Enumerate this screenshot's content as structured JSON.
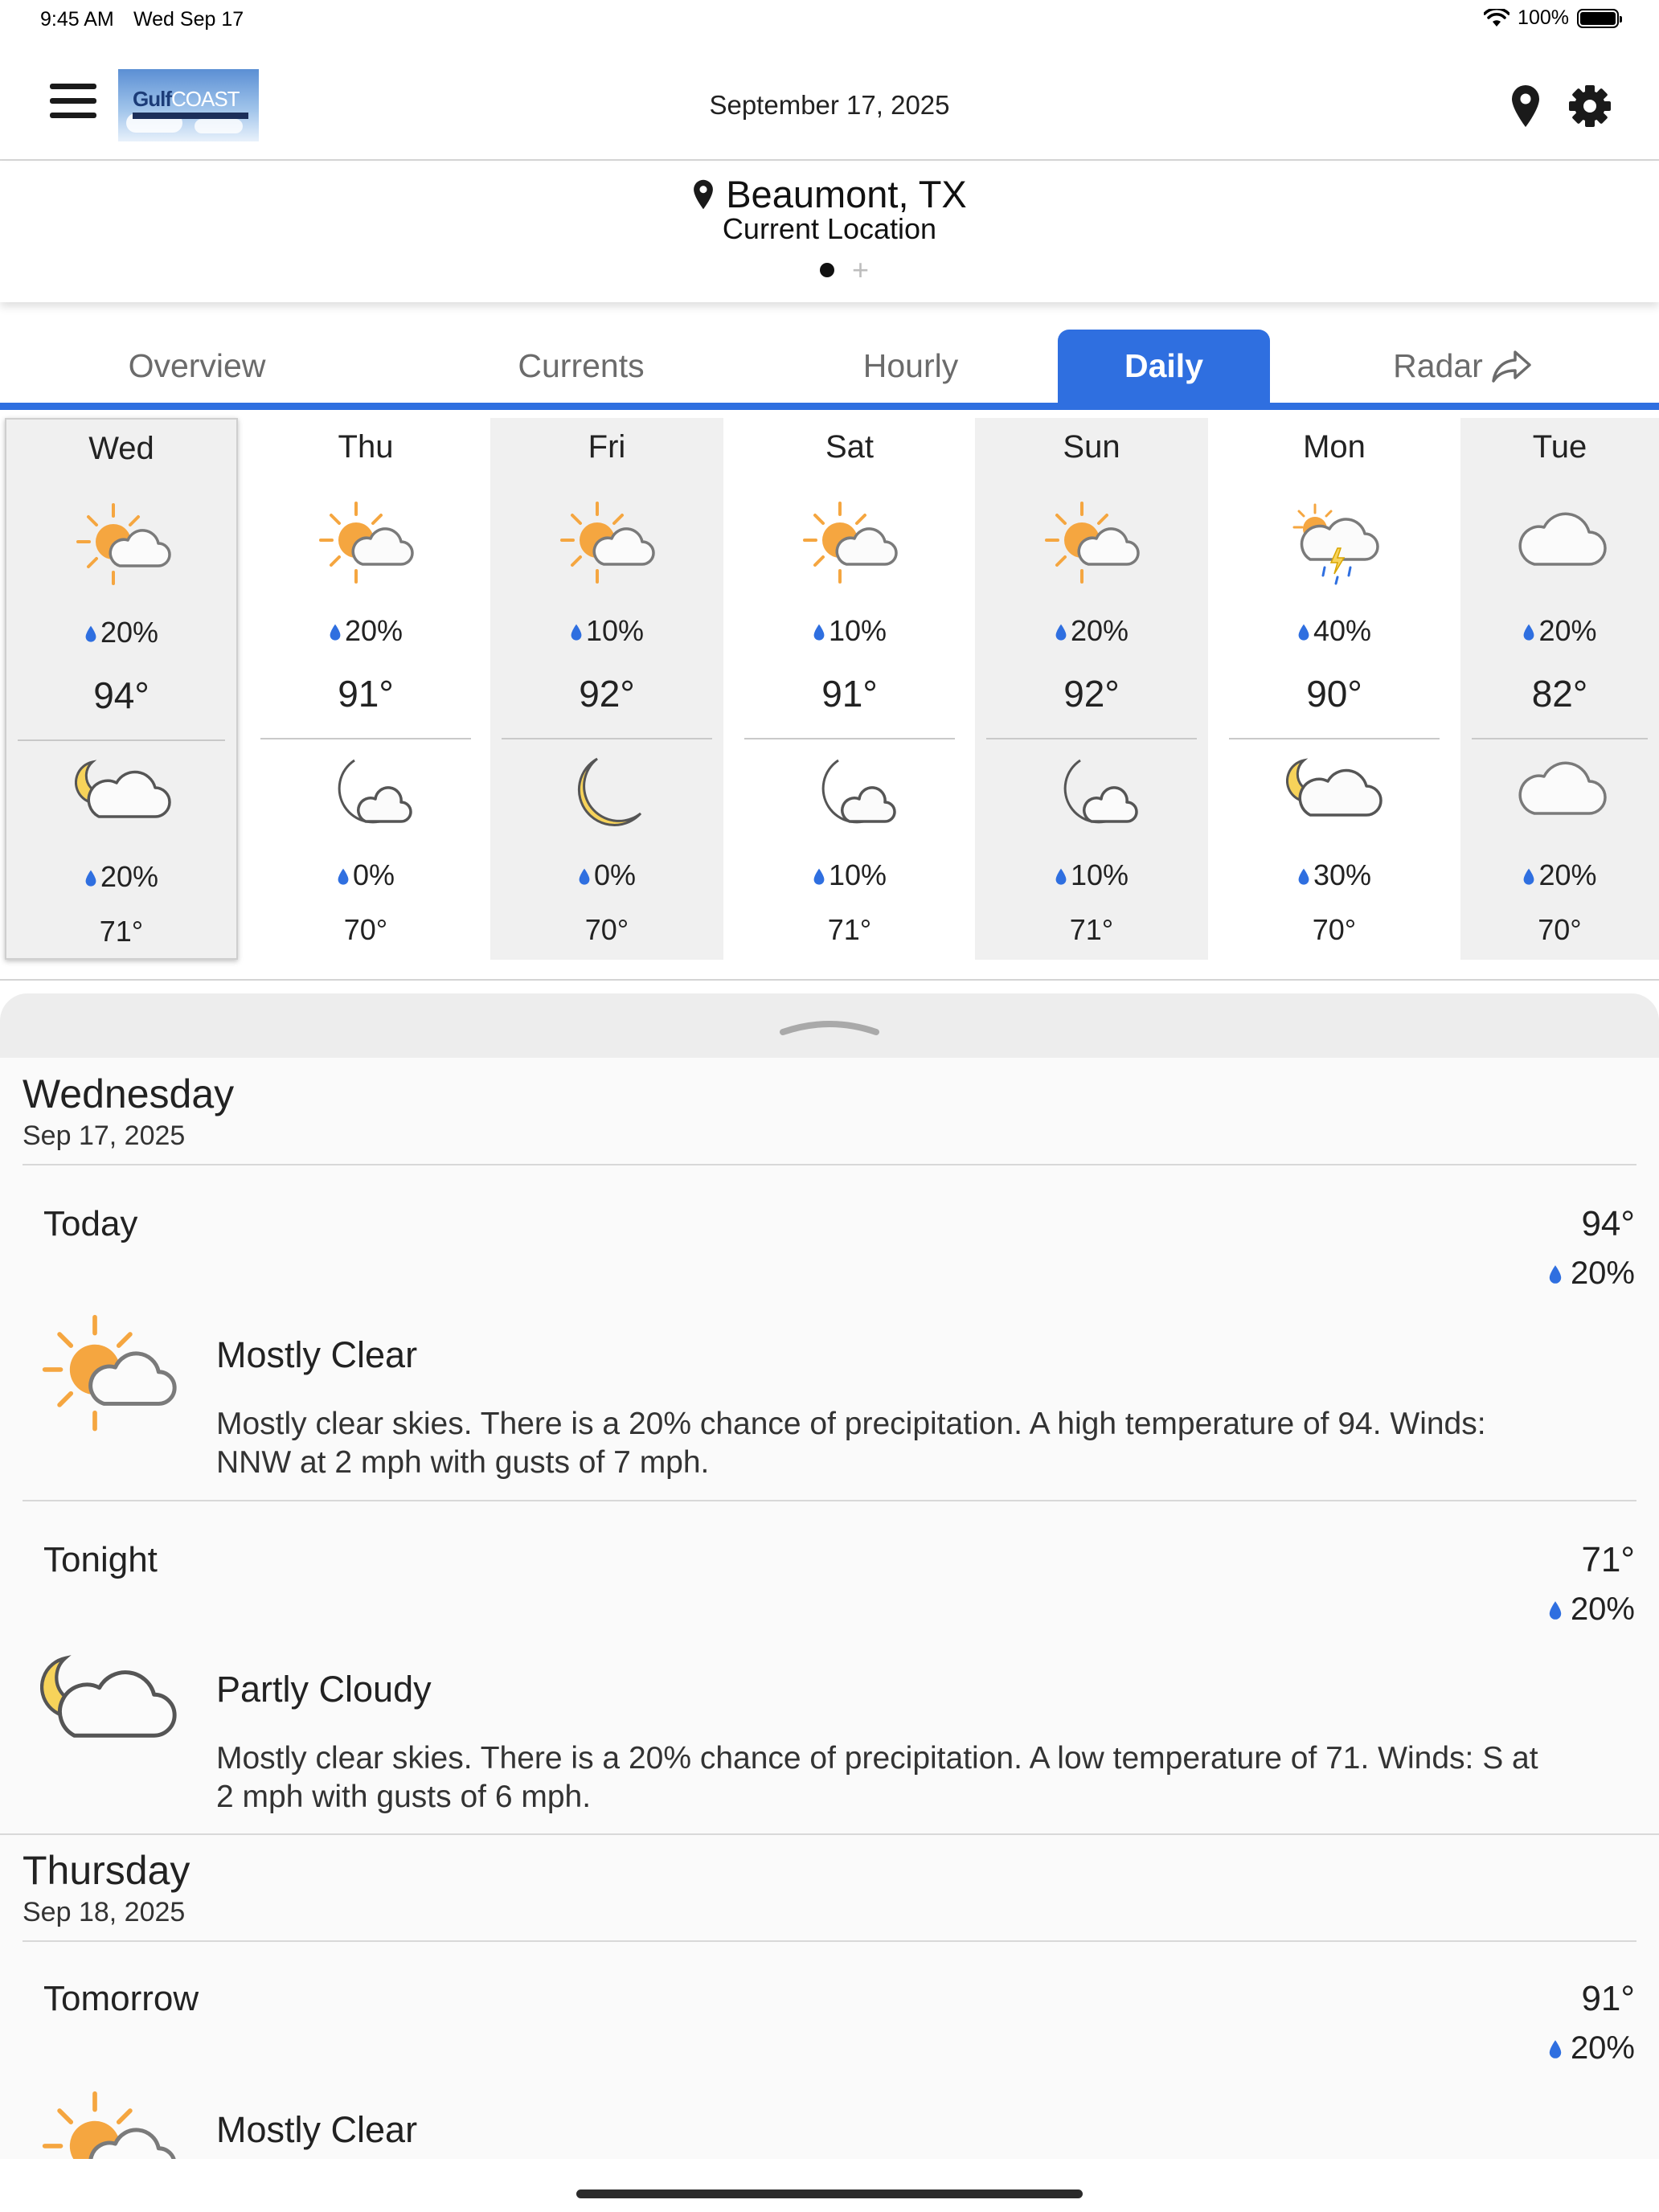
{
  "status_bar": {
    "time": "9:45 AM",
    "date": "Wed Sep 17",
    "battery": "100%",
    "battery_level": 1.0
  },
  "header": {
    "date": "September 17, 2025",
    "logo_text_a": "Gulf",
    "logo_text_b": "COAST"
  },
  "location": {
    "name": "Beaumont, TX",
    "subtitle": "Current Location"
  },
  "tabs": [
    {
      "label": "Overview"
    },
    {
      "label": "Currents"
    },
    {
      "label": "Hourly"
    },
    {
      "label": "Daily"
    },
    {
      "label": "Radar"
    }
  ],
  "days": [
    {
      "name": "Wed",
      "day_pop": "20%",
      "hi": "94°",
      "night_pop": "20%",
      "lo": "71°",
      "day_icon": "partly-sunny-icon",
      "night_icon": "partly-cloudy-night-icon"
    },
    {
      "name": "Thu",
      "day_pop": "20%",
      "hi": "91°",
      "night_pop": "0%",
      "lo": "70°",
      "day_icon": "partly-sunny-icon",
      "night_icon": "moon-cloud-icon"
    },
    {
      "name": "Fri",
      "day_pop": "10%",
      "hi": "92°",
      "night_pop": "0%",
      "lo": "70°",
      "day_icon": "partly-sunny-icon",
      "night_icon": "moon-icon"
    },
    {
      "name": "Sat",
      "day_pop": "10%",
      "hi": "91°",
      "night_pop": "10%",
      "lo": "71°",
      "day_icon": "partly-sunny-icon",
      "night_icon": "moon-cloud-icon"
    },
    {
      "name": "Sun",
      "day_pop": "20%",
      "hi": "92°",
      "night_pop": "10%",
      "lo": "71°",
      "day_icon": "partly-sunny-icon",
      "night_icon": "moon-cloud-icon"
    },
    {
      "name": "Mon",
      "day_pop": "40%",
      "hi": "90°",
      "night_pop": "30%",
      "lo": "70°",
      "day_icon": "thunderstorm-icon",
      "night_icon": "partly-cloudy-night-icon"
    },
    {
      "name": "Tue",
      "day_pop": "20%",
      "hi": "82°",
      "night_pop": "20%",
      "lo": "70°",
      "day_icon": "cloud-icon",
      "night_icon": "cloud-icon"
    }
  ],
  "details": {
    "wednesday": {
      "title": "Wednesday",
      "date": "Sep 17, 2025",
      "today": {
        "name": "Today",
        "temp": "94°",
        "pop": "20%",
        "condition": "Mostly Clear",
        "description": "Mostly clear skies. There is a 20% chance of precipitation. A high temperature of 94. Winds: NNW at 2 mph with gusts of 7 mph."
      },
      "tonight": {
        "name": "Tonight",
        "temp": "71°",
        "pop": "20%",
        "condition": "Partly Cloudy",
        "description": "Mostly clear skies. There is a 20% chance of precipitation. A low temperature of 71. Winds: S at 2 mph with gusts of 6 mph."
      }
    },
    "thursday": {
      "title": "Thursday",
      "date": "Sep 18, 2025",
      "tomorrow": {
        "name": "Tomorrow",
        "temp": "91°",
        "pop": "20%",
        "condition": "Mostly Clear"
      }
    }
  },
  "colors": {
    "accent": "#2f6fe0",
    "sun": "#f5a640",
    "moon": "#f7d35a",
    "drop": "#2f6fe0"
  }
}
